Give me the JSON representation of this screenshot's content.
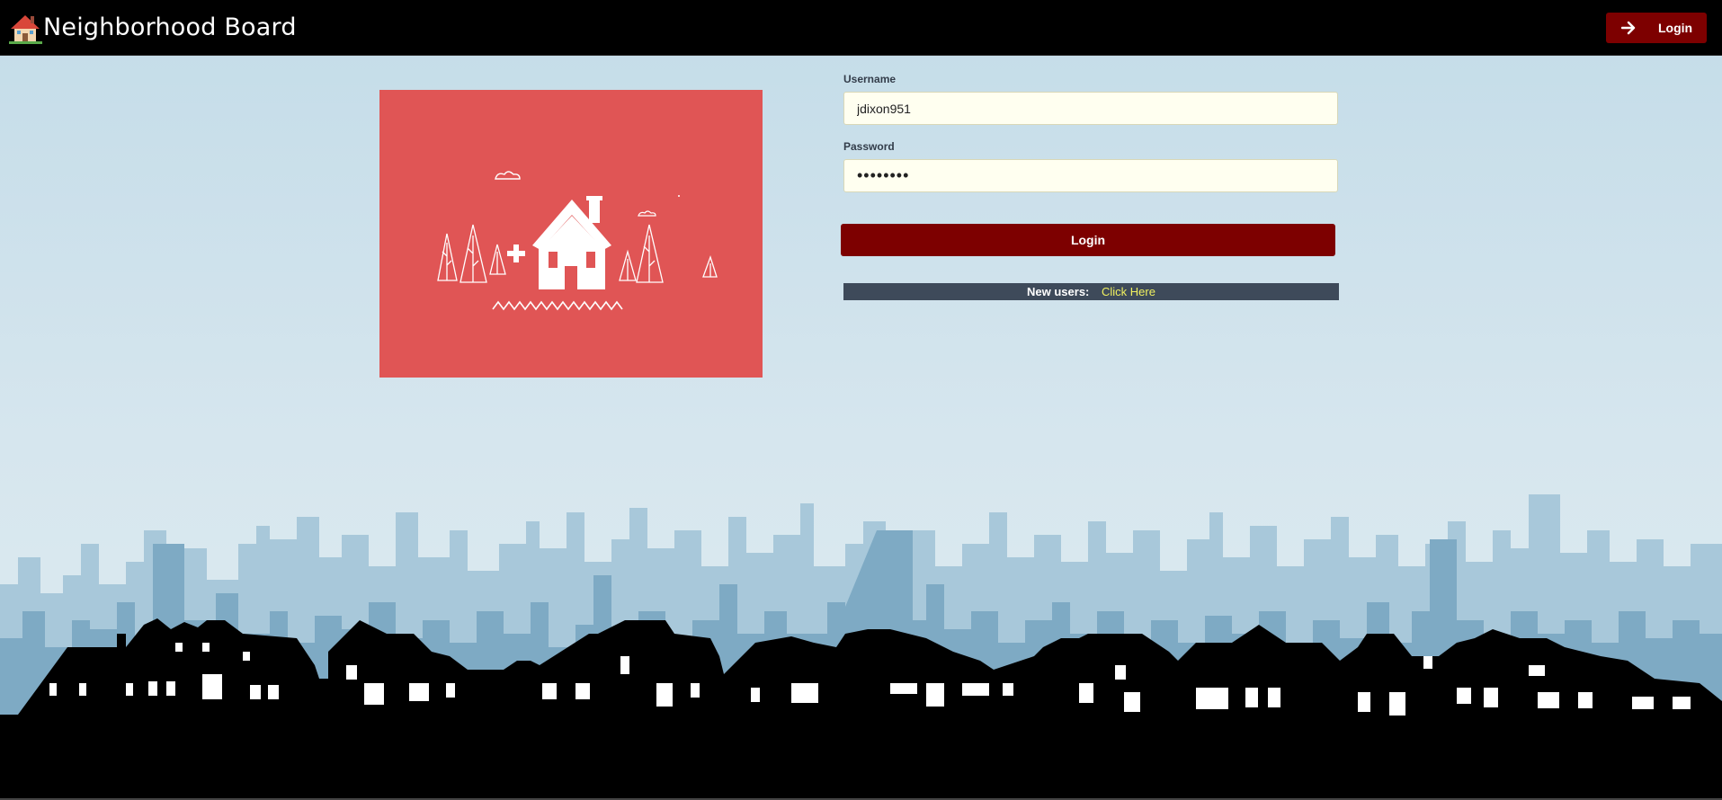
{
  "header": {
    "brand_title": "Neighborhood Board",
    "brand_icon": "house-icon",
    "login_label": "Login",
    "login_icon": "arrow-right-icon"
  },
  "login_form": {
    "username_label": "Username",
    "username_value": "jdixon951",
    "password_label": "Password",
    "password_value": "password",
    "submit_label": "Login",
    "new_users_text": "New users:",
    "new_users_link": "Click Here"
  },
  "colors": {
    "nav_bg": "#000000",
    "accent": "#7d0000",
    "hero_bg": "#e05555",
    "field_bg": "#fffff0",
    "banner_bg": "#3e4a5a",
    "link_color": "#f0f060"
  }
}
